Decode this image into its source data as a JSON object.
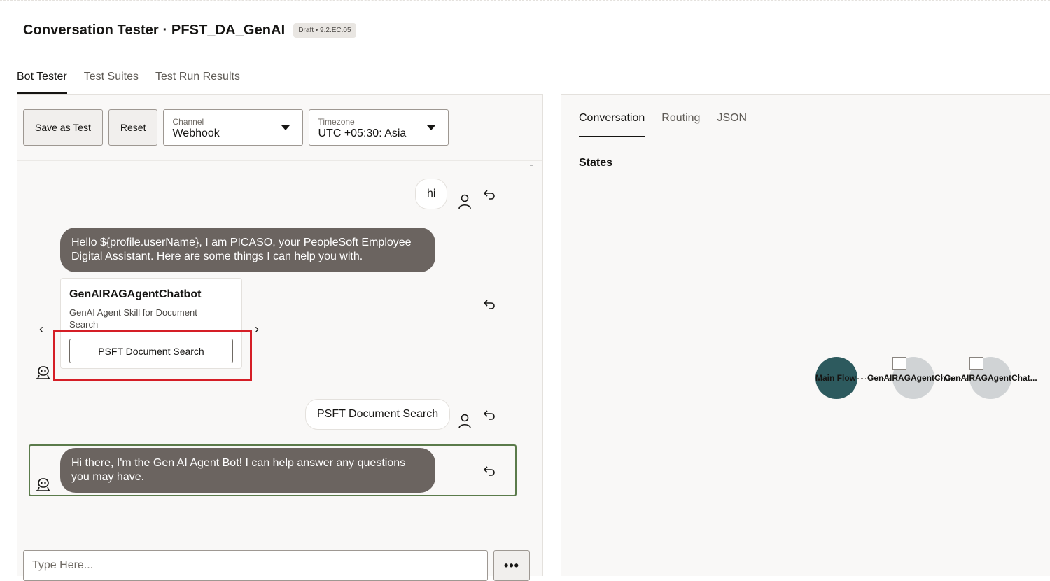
{
  "header": {
    "title": "Conversation Tester · PFST_DA_GenAI",
    "badge": "Draft • 9.2.EC.05"
  },
  "main_tabs": [
    {
      "label": "Bot Tester",
      "active": true
    },
    {
      "label": "Test Suites",
      "active": false
    },
    {
      "label": "Test Run Results",
      "active": false
    }
  ],
  "toolbar": {
    "save_label": "Save as Test",
    "reset_label": "Reset",
    "channel": {
      "label": "Channel",
      "value": "Webhook"
    },
    "timezone": {
      "label": "Timezone",
      "value": "UTC +05:30: Asia"
    }
  },
  "chat": {
    "messages": [
      {
        "from": "user",
        "text": "hi"
      },
      {
        "from": "bot",
        "text": "Hello ${profile.userName}, I am PICASO, your PeopleSoft Employee Digital Assistant. Here are some things I can help you with."
      },
      {
        "from": "bot-card",
        "title": "GenAIRAGAgentChatbot",
        "description": "GenAI Agent Skill for Document Search",
        "button": "PSFT Document Search"
      },
      {
        "from": "user",
        "text": "PSFT Document Search"
      },
      {
        "from": "bot",
        "text": "Hi there, I'm the Gen AI Agent Bot! I can help answer any questions you may have."
      }
    ]
  },
  "input": {
    "placeholder": "Type Here...",
    "more_label": "•••"
  },
  "right_panel": {
    "tabs": [
      {
        "label": "Conversation",
        "active": true
      },
      {
        "label": "Routing",
        "active": false
      },
      {
        "label": "JSON",
        "active": false
      }
    ],
    "states_label": "States",
    "nodes": [
      {
        "label": "Main Flow",
        "color": "#2d5a5e"
      },
      {
        "label": "GenAIRAGAgentCh...",
        "color": "#d0d3d5"
      },
      {
        "label": "GenAIRAGAgentChat...",
        "color": "#d0d3d5"
      }
    ]
  },
  "colors": {
    "bot_bubble": "#6b6460",
    "highlight": "#d51e26",
    "selected_border": "#5b7b4b"
  }
}
